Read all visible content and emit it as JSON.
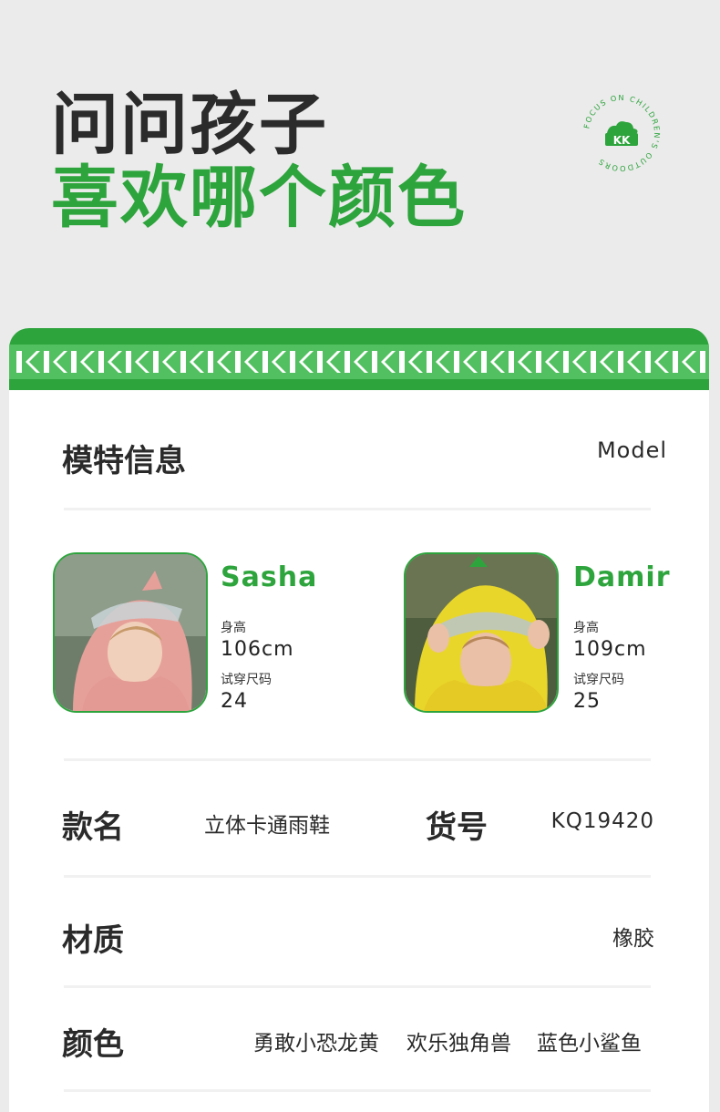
{
  "hero": {
    "line1": "问问孩子",
    "line2": "喜欢哪个颜色"
  },
  "badge": {
    "logo_text": "KK",
    "ring_text": "FOCUS ON CHILDREN'S OUTDOORS"
  },
  "model_section": {
    "title": "模特信息",
    "subtitle": "Model"
  },
  "models": [
    {
      "name": "Sasha",
      "height_label": "身高",
      "height_value": "106cm",
      "size_label": "试穿尺码",
      "size_value": "24",
      "outfit_color": "#e6a09a"
    },
    {
      "name": "Damir",
      "height_label": "身高",
      "height_value": "109cm",
      "size_label": "试穿尺码",
      "size_value": "25",
      "outfit_color": "#e9d62a"
    }
  ],
  "product": {
    "name_label": "款名",
    "name_value": "立体卡通雨鞋",
    "sku_label": "货号",
    "sku_value": "KQ19420"
  },
  "material": {
    "label": "材质",
    "value": "橡胶"
  },
  "colors": {
    "label": "颜色",
    "options": [
      "勇敢小恐龙黄",
      "欢乐独角兽",
      "蓝色小鲨鱼"
    ]
  },
  "theme": {
    "brand_green": "#2ea43d",
    "stripe_green": "#52c060",
    "background": "#ebebeb"
  }
}
